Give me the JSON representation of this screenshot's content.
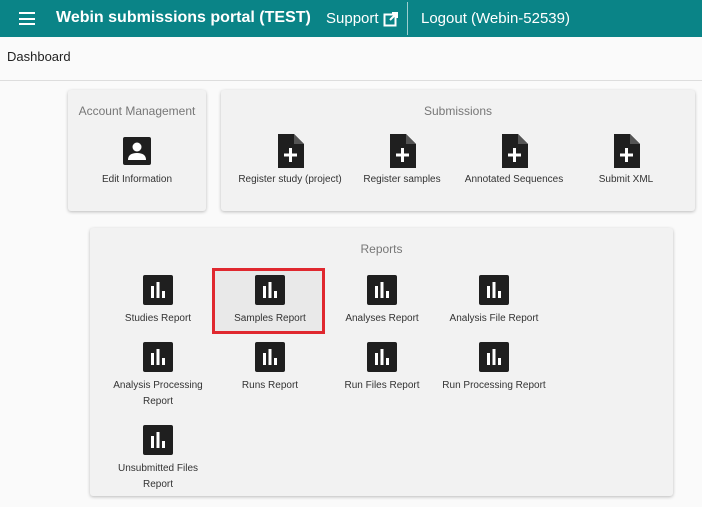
{
  "header": {
    "title": "Webin submissions portal (TEST)",
    "support_label": "Support",
    "logout_label": "Logout (Webin-52539)"
  },
  "breadcrumb": "Dashboard",
  "account": {
    "title": "Account Management",
    "items": [
      {
        "label": "Edit Information",
        "icon": "person-icon"
      }
    ]
  },
  "submissions": {
    "title": "Submissions",
    "items": [
      {
        "label": "Register study (project)",
        "icon": "file-add-icon"
      },
      {
        "label": "Register samples",
        "icon": "file-add-icon"
      },
      {
        "label": "Annotated Sequences",
        "icon": "file-add-icon"
      },
      {
        "label": "Submit XML",
        "icon": "file-add-icon"
      }
    ]
  },
  "reports": {
    "title": "Reports",
    "items": [
      {
        "label": "Studies Report",
        "icon": "bar-chart-icon"
      },
      {
        "label": "Samples Report",
        "icon": "bar-chart-icon"
      },
      {
        "label": "Analyses Report",
        "icon": "bar-chart-icon"
      },
      {
        "label": "Analysis File Report",
        "icon": "bar-chart-icon"
      },
      {
        "label": "Analysis Processing Report",
        "icon": "bar-chart-icon"
      },
      {
        "label": "Runs Report",
        "icon": "bar-chart-icon"
      },
      {
        "label": "Run Files Report",
        "icon": "bar-chart-icon"
      },
      {
        "label": "Run Processing Report",
        "icon": "bar-chart-icon"
      },
      {
        "label": "Unsubmitted Files Report",
        "icon": "bar-chart-icon"
      }
    ]
  },
  "colors": {
    "header": "#0a8487",
    "highlight": "#e0282f"
  }
}
